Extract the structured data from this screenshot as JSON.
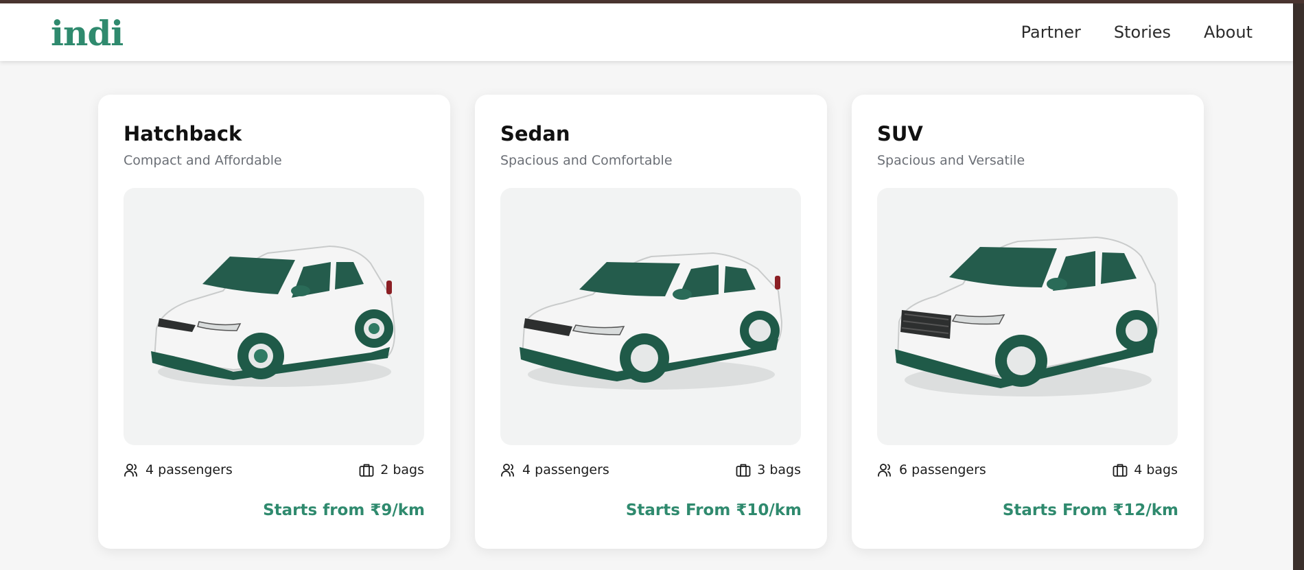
{
  "header": {
    "logo": "indi",
    "nav": [
      {
        "label": "Partner"
      },
      {
        "label": "Stories"
      },
      {
        "label": "About"
      }
    ]
  },
  "colors": {
    "brand": "#2f8a6e",
    "header_strip": "#4a3530"
  },
  "cards": [
    {
      "title": "Hatchback",
      "subtitle": "Compact and Affordable",
      "image_alt": "White hatchback car",
      "passengers": "4 passengers",
      "bags": "2 bags",
      "price": "Starts from ₹9/km"
    },
    {
      "title": "Sedan",
      "subtitle": "Spacious and Comfortable",
      "image_alt": "White sedan car",
      "passengers": "4 passengers",
      "bags": "3 bags",
      "price": "Starts From ₹10/km"
    },
    {
      "title": "SUV",
      "subtitle": "Spacious and Versatile",
      "image_alt": "White SUV car",
      "passengers": "6 passengers",
      "bags": "4 bags",
      "price": "Starts From ₹12/km"
    }
  ],
  "icons": {
    "passengers": "users-icon",
    "bags": "luggage-icon"
  }
}
